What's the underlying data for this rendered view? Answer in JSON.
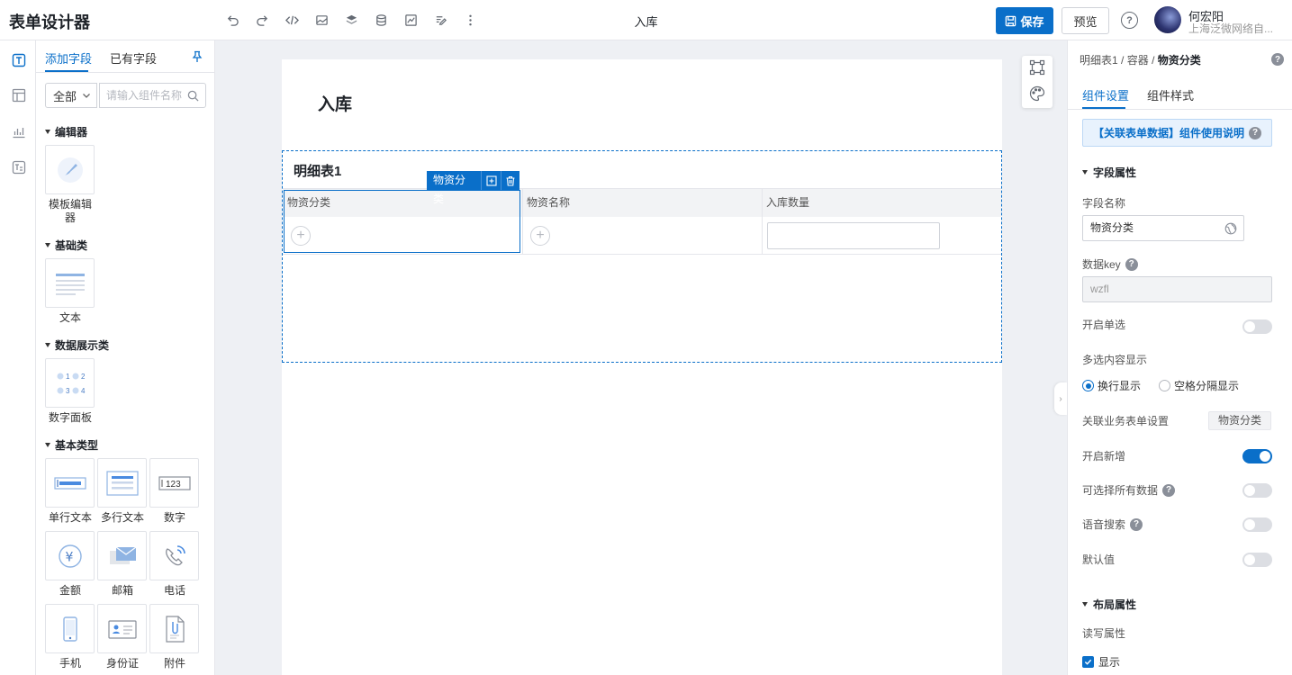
{
  "app": {
    "title": "表单设计器",
    "form_name": "入库"
  },
  "topbar": {
    "save_label": "保存",
    "preview_label": "预览",
    "help_symbol": "?",
    "user_name": "何宏阳",
    "user_org": "上海泛微网络自...",
    "tool_icons": [
      "undo-icon",
      "redo-icon",
      "code-icon",
      "image-icon",
      "layers-icon",
      "database-icon",
      "chart-icon",
      "edit-icon",
      "more-icon"
    ]
  },
  "rail": {
    "icons": [
      "text-field-icon",
      "layout-icon",
      "chart-icon",
      "template-icon"
    ]
  },
  "components": {
    "tabs": [
      "添加字段",
      "已有字段"
    ],
    "filter": {
      "selected": "全部"
    },
    "search": {
      "placeholder": "请输入组件名称"
    },
    "groups": [
      {
        "title": "编辑器",
        "items": [
          {
            "label": "模板编辑器",
            "icon": "template-editor-icon"
          }
        ]
      },
      {
        "title": "基础类",
        "items": [
          {
            "label": "文本",
            "icon": "text-icon"
          }
        ]
      },
      {
        "title": "数据展示类",
        "items": [
          {
            "label": "数字面板",
            "icon": "number-panel-icon"
          }
        ]
      },
      {
        "title": "基本类型",
        "items": [
          {
            "label": "单行文本",
            "icon": "single-line-icon"
          },
          {
            "label": "多行文本",
            "icon": "multi-line-icon"
          },
          {
            "label": "数字",
            "icon": "number-icon",
            "glyph": "123"
          },
          {
            "label": "金额",
            "icon": "currency-icon",
            "glyph": "¥"
          },
          {
            "label": "邮箱",
            "icon": "mail-icon"
          },
          {
            "label": "电话",
            "icon": "phone-icon"
          },
          {
            "label": "手机",
            "icon": "mobile-icon"
          },
          {
            "label": "身份证",
            "icon": "id-card-icon"
          },
          {
            "label": "附件",
            "icon": "attachment-icon"
          }
        ]
      }
    ]
  },
  "canvas": {
    "form_title": "入库",
    "detail_table": {
      "title": "明细表1",
      "columns": [
        "物资分类",
        "物资名称",
        "入库数量"
      ],
      "selected_column": "物资分类",
      "add_symbol": "+"
    }
  },
  "properties": {
    "breadcrumb": [
      "明细表1",
      "容器",
      "物资分类"
    ],
    "breadcrumb_separator": "/",
    "tabs": [
      "组件设置",
      "组件样式"
    ],
    "notice": "【关联表单数据】组件使用说明",
    "field_section": "字段属性",
    "field_name_label": "字段名称",
    "field_name_value": "物资分类",
    "data_key_label": "数据key",
    "data_key_value": "wzfl",
    "single_select_label": "开启单选",
    "single_select_on": false,
    "multi_display_label": "多选内容显示",
    "multi_display_options": [
      "换行显示",
      "空格分隔显示"
    ],
    "multi_display_selected": "换行显示",
    "linked_form_label": "关联业务表单设置",
    "linked_form_value": "物资分类",
    "enable_add_label": "开启新增",
    "enable_add_on": true,
    "select_all_label": "可选择所有数据",
    "select_all_on": false,
    "voice_search_label": "语音搜索",
    "voice_search_on": false,
    "default_value_label": "默认值",
    "default_value_on": false,
    "layout_section": "布局属性",
    "read_write_label": "读写属性",
    "visible_label": "显示",
    "visible_checked": true
  },
  "colors": {
    "primary": "#0a6fc9",
    "border": "#e5e6eb",
    "canvas_bg": "#eef0f4",
    "header_bg": "#f2f3f5"
  }
}
